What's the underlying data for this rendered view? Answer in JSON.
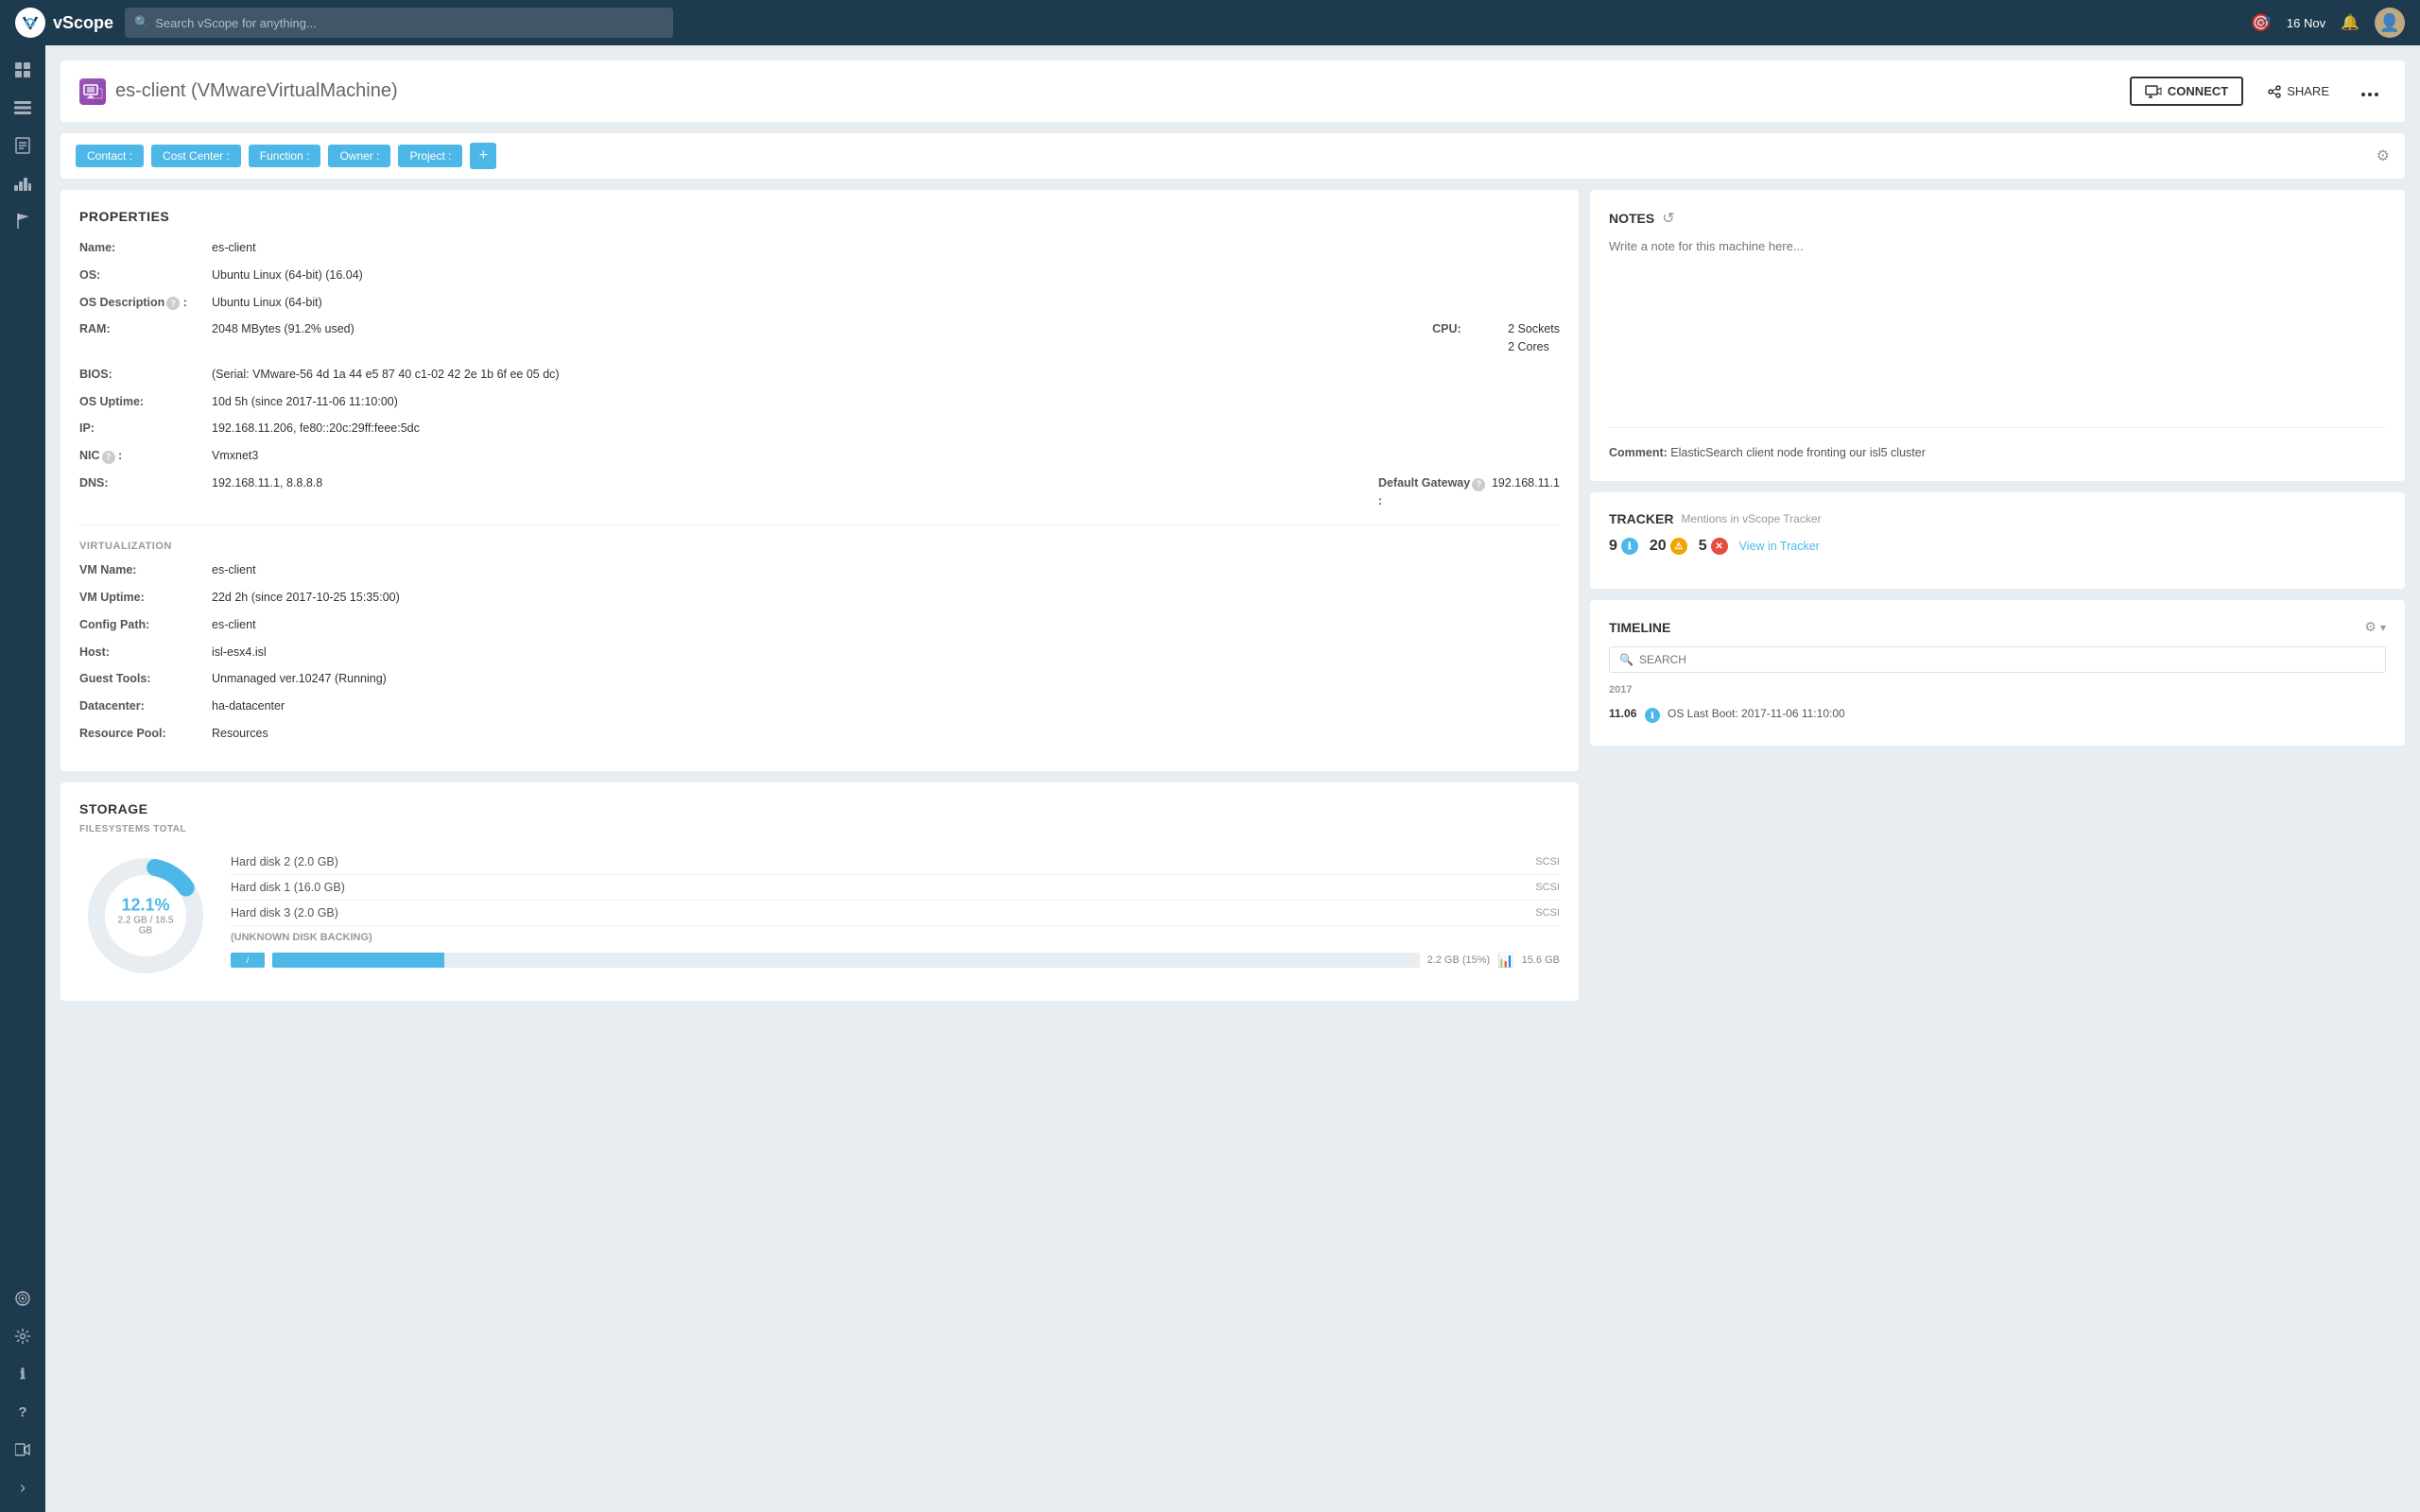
{
  "topnav": {
    "logo_text": "vScope",
    "search_placeholder": "Search vScope for anything...",
    "date": "16 Nov",
    "logo_letter": "vS"
  },
  "sidebar": {
    "items": [
      {
        "id": "grid",
        "icon": "⊞",
        "active": false
      },
      {
        "id": "table",
        "icon": "☰",
        "active": false
      },
      {
        "id": "notes",
        "icon": "📋",
        "active": false
      },
      {
        "id": "chart",
        "icon": "📊",
        "active": false
      },
      {
        "id": "flag",
        "icon": "⚑",
        "active": false
      }
    ],
    "bottom_items": [
      {
        "id": "radar",
        "icon": "◎"
      },
      {
        "id": "gear2",
        "icon": "⚙"
      },
      {
        "id": "info",
        "icon": "ℹ"
      },
      {
        "id": "help",
        "icon": "?"
      },
      {
        "id": "video",
        "icon": "▶"
      },
      {
        "id": "expand",
        "icon": "›"
      }
    ]
  },
  "header": {
    "device_name": "es-client",
    "device_type": "(VMwareVirtualMachine)",
    "connect_label": "CONNECT",
    "share_label": "SHARE"
  },
  "tags": {
    "items": [
      {
        "label": "Contact :",
        "active": true
      },
      {
        "label": "Cost Center :",
        "active": true
      },
      {
        "label": "Function :",
        "active": true
      },
      {
        "label": "Owner :",
        "active": true
      },
      {
        "label": "Project :",
        "active": true
      }
    ],
    "add_label": "+"
  },
  "properties": {
    "title": "PROPERTIES",
    "fields": [
      {
        "label": "Name:",
        "value": "es-client"
      },
      {
        "label": "OS:",
        "value": "Ubuntu Linux (64-bit) (16.04)"
      },
      {
        "label": "OS Description:",
        "value": "Ubuntu Linux (64-bit)",
        "has_help": true
      },
      {
        "label": "RAM:",
        "value": "2048 MBytes (91.2% used)"
      },
      {
        "label": "CPU:",
        "value1": "2 Sockets",
        "value2": "2 Cores"
      },
      {
        "label": "BIOS:",
        "value": "(Serial: VMware-56 4d 1a 44 e5 87 40 c1-02 42 2e 1b 6f ee 05 dc)"
      },
      {
        "label": "OS Uptime:",
        "value": "10d 5h (since 2017-11-06 11:10:00)"
      },
      {
        "label": "IP:",
        "value": "192.168.11.206, fe80::20c:29ff:feee:5dc"
      },
      {
        "label": "NIC:",
        "value": "Vmxnet3",
        "has_help": true
      },
      {
        "label": "DNS:",
        "value": "192.168.11.1, 8.8.8.8"
      },
      {
        "label": "Default Gateway:",
        "value": "192.168.11.1",
        "has_help": true
      }
    ],
    "virtualization_title": "VIRTUALIZATION",
    "virt_fields": [
      {
        "label": "VM Name:",
        "value": "es-client"
      },
      {
        "label": "VM Uptime:",
        "value": "22d 2h (since 2017-10-25 15:35:00)"
      },
      {
        "label": "Config Path:",
        "value": "es-client"
      },
      {
        "label": "Host:",
        "value": "isl-esx4.isl"
      },
      {
        "label": "Guest Tools:",
        "value": "Unmanaged ver.10247 (Running)"
      },
      {
        "label": "Datacenter:",
        "value": "ha-datacenter"
      },
      {
        "label": "Resource Pool:",
        "value": "Resources"
      }
    ]
  },
  "notes": {
    "title": "NOTES",
    "placeholder": "Write a note for this machine here...",
    "comment_label": "Comment:",
    "comment_text": "ElasticSearch client node fronting our isl5 cluster"
  },
  "storage": {
    "title": "STORAGE",
    "fs_label": "FILESYSTEMS TOTAL",
    "donut_pct": "12.1%",
    "donut_sub": "2.2 GB / 18.5 GB",
    "disks": [
      {
        "name": "Hard disk 2 (2.0 GB)",
        "type": "SCSI"
      },
      {
        "name": "Hard disk 1 (16.0 GB)",
        "type": "SCSI"
      },
      {
        "name": "Hard disk 3 (2.0 GB)",
        "type": "SCSI"
      }
    ],
    "unknown_label": "(UNKNOWN DISK BACKING)",
    "fs_path": "/",
    "fs_pct": "2.2 GB (15%)",
    "fs_total": "15.6 GB"
  },
  "tracker": {
    "title": "TRACKER",
    "subtitle": "Mentions in vScope Tracker",
    "counts": [
      {
        "value": "9",
        "type": "info"
      },
      {
        "value": "20",
        "type": "warn"
      },
      {
        "value": "5",
        "type": "err"
      }
    ],
    "view_label": "View in Tracker"
  },
  "timeline": {
    "title": "TIMELINE",
    "search_placeholder": "SEARCH",
    "year": "2017",
    "entries": [
      {
        "date": "11.06",
        "type": "info",
        "text": "OS Last Boot: 2017-11-06 11:10:00"
      }
    ]
  }
}
